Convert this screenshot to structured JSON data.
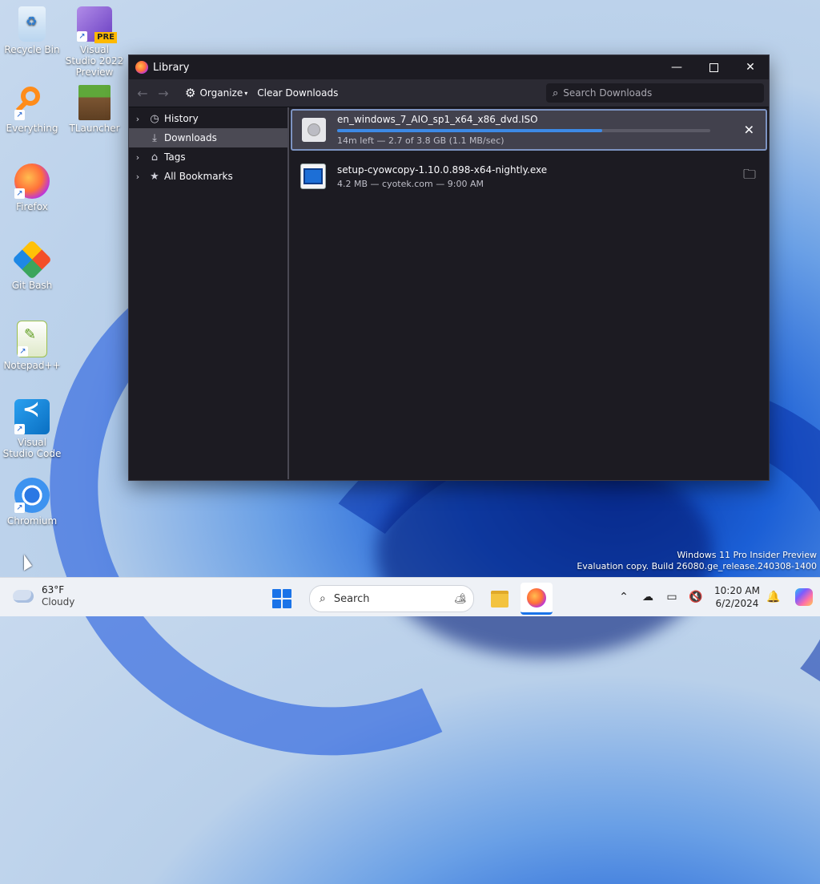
{
  "desktop": {
    "icons": [
      {
        "label": "Recycle Bin"
      },
      {
        "label": "Visual Studio 2022 Preview",
        "badge": "PRE"
      },
      {
        "label": "Everything"
      },
      {
        "label": "TLauncher"
      },
      {
        "label": "Firefox"
      },
      {
        "label": "Git Bash"
      },
      {
        "label": "Notepad++"
      },
      {
        "label": "Visual Studio Code"
      },
      {
        "label": "Chromium"
      }
    ]
  },
  "window": {
    "title": "Library",
    "toolbar": {
      "organize_label": "Organize",
      "clear_label": "Clear Downloads",
      "search_placeholder": "Search Downloads"
    },
    "sidebar": {
      "items": [
        {
          "label": "History",
          "icon": "clock-icon",
          "expandable": true
        },
        {
          "label": "Downloads",
          "icon": "download-icon",
          "expandable": false,
          "selected": true
        },
        {
          "label": "Tags",
          "icon": "tag-icon",
          "expandable": true
        },
        {
          "label": "All Bookmarks",
          "icon": "star-icon",
          "expandable": true
        }
      ]
    },
    "downloads": [
      {
        "name": "en_windows_7_AIO_sp1_x64_x86_dvd.ISO",
        "status": "14m left — 2.7 of 3.8 GB (1.1 MB/sec)",
        "progress": 0.71,
        "action": "cancel"
      },
      {
        "name": "setup-cyowcopy-1.10.0.898-x64-nightly.exe",
        "status": "4.2 MB — cyotek.com — 9:00 AM",
        "action": "open-folder"
      }
    ]
  },
  "watermark": {
    "line1": "Windows 11 Pro Insider Preview",
    "line2": "Evaluation copy. Build 26080.ge_release.240308-1400"
  },
  "taskbar": {
    "weather_temp": "63°F",
    "weather_desc": "Cloudy",
    "search_placeholder": "Search",
    "time": "10:20 AM",
    "date": "6/2/2024"
  },
  "colors": {
    "accent": "#3d8ae6",
    "window_bg": "#1c1b22",
    "toolbar_bg": "#2b2a33",
    "selection": "#42414d"
  }
}
